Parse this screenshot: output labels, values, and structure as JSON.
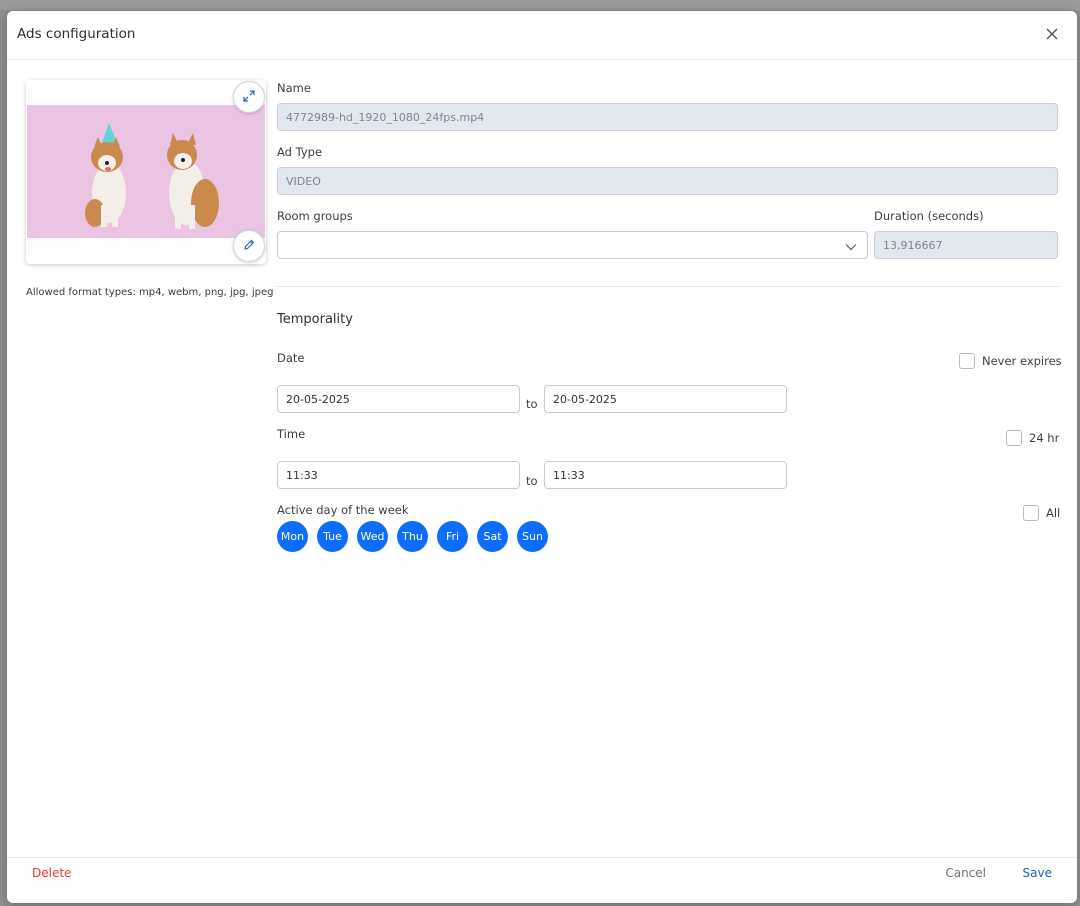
{
  "dialog": {
    "title": "Ads configuration"
  },
  "media": {
    "expand_icon": "expand-icon",
    "edit_icon": "pencil-icon",
    "allowed_formats": "Allowed format types: mp4, webm, png, jpg, jpeg"
  },
  "form": {
    "name_label": "Name",
    "name_value": "4772989-hd_1920_1080_24fps.mp4",
    "ad_type_label": "Ad Type",
    "ad_type_value": "VIDEO",
    "room_groups_label": "Room groups",
    "room_groups_value": "",
    "duration_label": "Duration (seconds)",
    "duration_value": "13,916667"
  },
  "temporality": {
    "title": "Temporality",
    "date_label": "Date",
    "never_expires_label": "Never expires",
    "date_from": "20-05-2025",
    "date_to": "20-05-2025",
    "to_label": "to",
    "time_label": "Time",
    "hr24_label": "24 hr",
    "time_from": "11:33",
    "time_to": "11:33",
    "active_days_label": "Active day of the week",
    "all_label": "All",
    "days": [
      "Mon",
      "Tue",
      "Wed",
      "Thu",
      "Fri",
      "Sat",
      "Sun"
    ]
  },
  "footer": {
    "delete": "Delete",
    "cancel": "Cancel",
    "save": "Save"
  },
  "colors": {
    "accent": "#0d6efd",
    "danger": "#e53935",
    "disabled_bg": "#e2e8f0"
  }
}
